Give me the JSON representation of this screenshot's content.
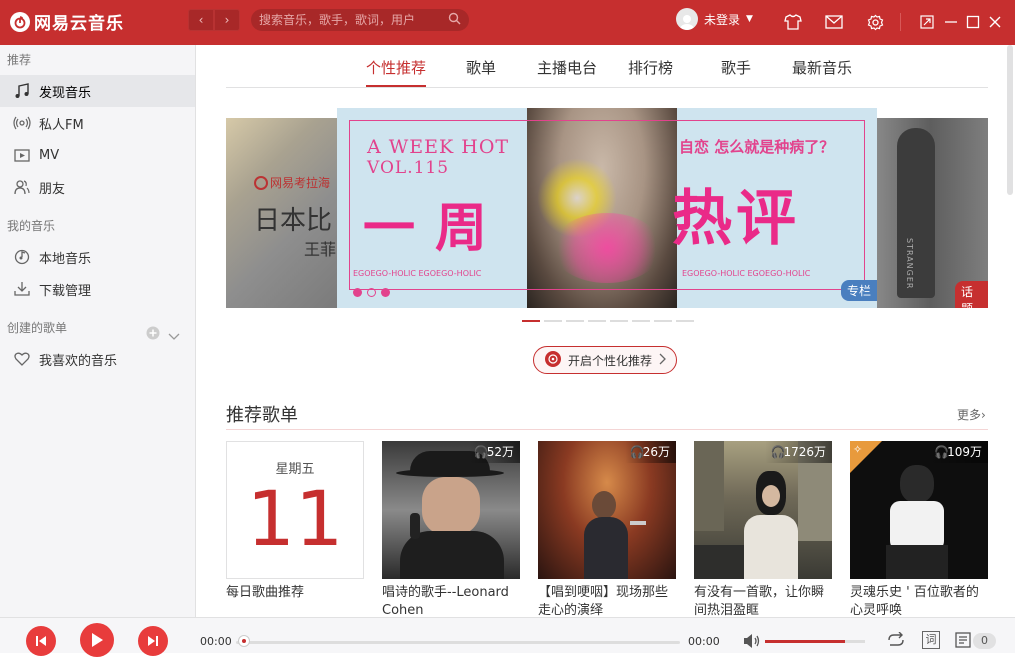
{
  "app": {
    "title": "网易云音乐"
  },
  "nav": {
    "back": "‹",
    "forward": "›"
  },
  "search": {
    "placeholder": "搜索音乐，歌手，歌词，用户"
  },
  "user": {
    "name": "未登录"
  },
  "sidebar": {
    "section_recommend": "推荐",
    "items_recommend": [
      {
        "label": "发现音乐",
        "icon": "music-note-icon",
        "active": true
      },
      {
        "label": "私人FM",
        "icon": "radio-icon"
      },
      {
        "label": "MV",
        "icon": "video-icon"
      },
      {
        "label": "朋友",
        "icon": "friends-icon"
      }
    ],
    "section_mymusic": "我的音乐",
    "items_mymusic": [
      {
        "label": "本地音乐",
        "icon": "local-music-icon"
      },
      {
        "label": "下载管理",
        "icon": "download-icon"
      }
    ],
    "section_created": "创建的歌单",
    "items_created": [
      {
        "label": "我喜欢的音乐",
        "icon": "heart-icon"
      }
    ]
  },
  "tabs": [
    "个性推荐",
    "歌单",
    "主播电台",
    "排行榜",
    "歌手",
    "最新音乐"
  ],
  "banner": {
    "center": {
      "line1": "A WEEK HOT",
      "line2": "VOL.115",
      "subtitle": "自恋 怎么就是种病了？",
      "big_left": "一周",
      "big_right": "热评",
      "footer_left": "EGOEGO-HOLIC EGOEGO-HOLIC",
      "footer_right": "EGOEGO-HOLIC EGOEGO-HOLIC",
      "tag": "专栏"
    },
    "left": {
      "brand": "网易考拉海",
      "title": "日本比",
      "subtitle": "王菲"
    },
    "right": {
      "tag": "话题",
      "text": "STRANGER"
    },
    "dots": 8,
    "active_dot": 0
  },
  "personalize": {
    "label": "开启个性化推荐"
  },
  "recommend": {
    "title": "推荐歌单",
    "more": "更多",
    "daily": {
      "weekday": "星期五",
      "day": "11",
      "title": "每日歌曲推荐"
    },
    "playlists": [
      {
        "count": "52万",
        "title": "唱诗的歌手--Leonard Cohen"
      },
      {
        "count": "26万",
        "title": "【唱到哽咽】现场那些走心的演绎"
      },
      {
        "count": "1726万",
        "title": "有没有一首歌，让你瞬间热泪盈眶"
      },
      {
        "count": "109万",
        "title": "灵魂乐史 ' 百位歌者的心灵呼唤"
      }
    ]
  },
  "player": {
    "current_time": "00:00",
    "total_time": "00:00",
    "progress": 0,
    "volume": 0.8,
    "lyrics_btn": "词",
    "playlist_count": "0"
  }
}
